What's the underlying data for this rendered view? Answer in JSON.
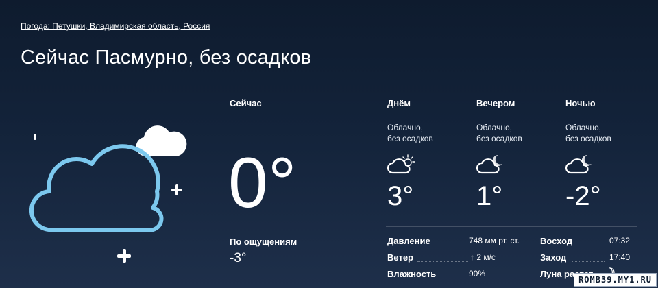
{
  "breadcrumb": "Погода: Петушки, Владимирская область, Россия",
  "title": "Сейчас Пасмурно, без осадков",
  "now": {
    "header": "Сейчас",
    "temp": "0°",
    "feels_label": "По ощущениям",
    "feels_value": "-3°",
    "icon": "cloudy-night-icon"
  },
  "periods": [
    {
      "header": "Днём",
      "desc": "Облачно,\nбез осадков",
      "temp": "3°",
      "icon": "cloud-sun-icon"
    },
    {
      "header": "Вечером",
      "desc": "Облачно,\nбез осадков",
      "temp": "1°",
      "icon": "cloud-moon-icon"
    },
    {
      "header": "Ночью",
      "desc": "Облачно,\nбез осадков",
      "temp": "-2°",
      "icon": "cloud-moon-icon"
    }
  ],
  "details": {
    "pressure_label": "Давление",
    "pressure_value": "748 мм рт. ст.",
    "wind_label": "Ветер",
    "wind_arrow": "↑",
    "wind_value": "2 м/с",
    "humidity_label": "Влажность",
    "humidity_value": "90%",
    "sunrise_label": "Восход",
    "sunrise_value": "07:32",
    "sunset_label": "Заход",
    "sunset_value": "17:40",
    "moon_label": "Луна растет",
    "moon_icon": "moon-crescent-icon"
  },
  "watermark": "ROMB39.MY1.RU",
  "colors": {
    "background_top": "#0e1b2e",
    "background_bottom": "#1e2f4a",
    "icon_stroke": "#7cc8ee",
    "text": "#ffffff"
  }
}
